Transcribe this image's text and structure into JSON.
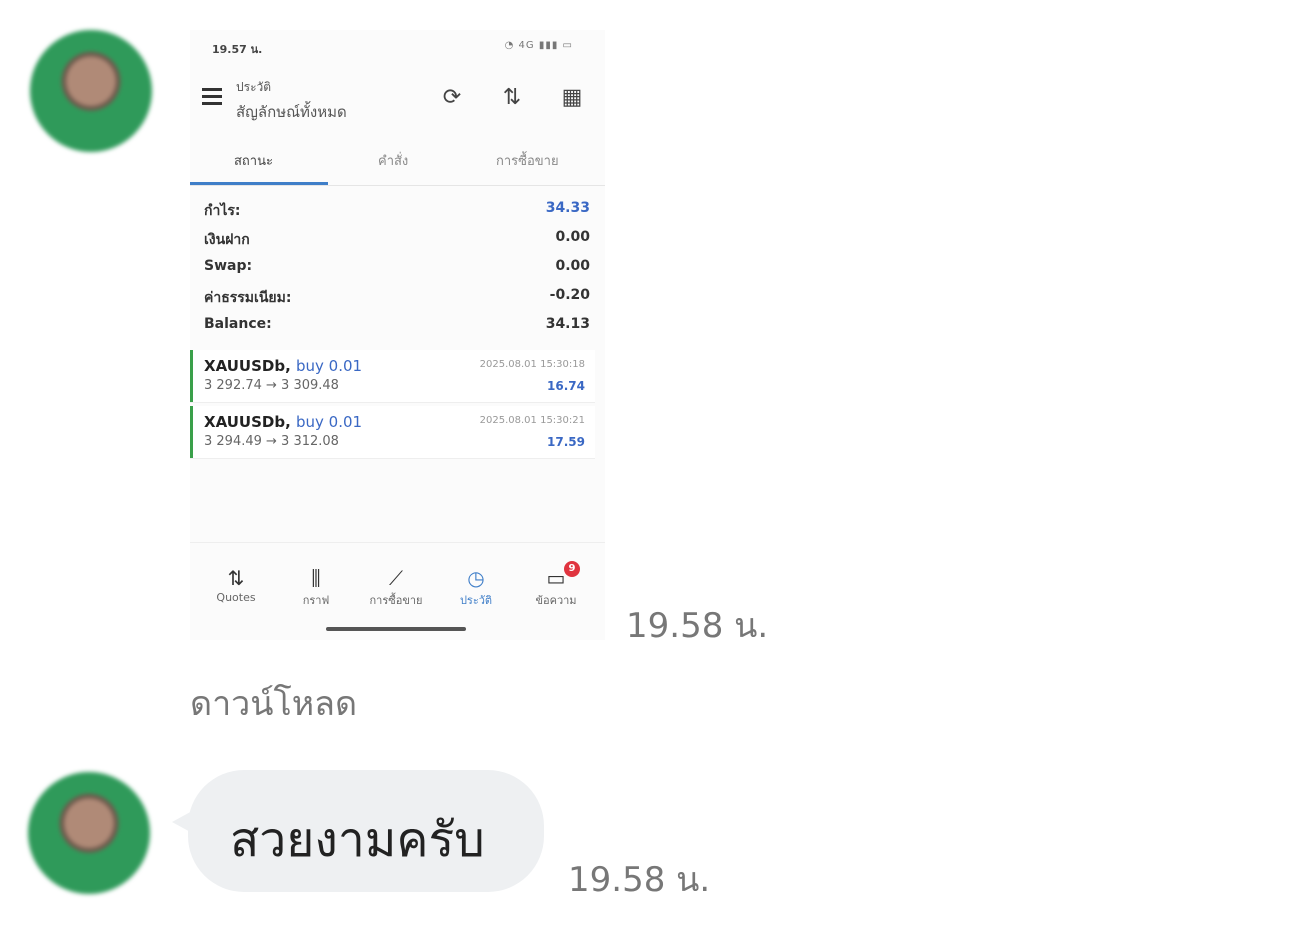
{
  "avatar_icon": "user-avatar",
  "screenshot": {
    "status_time": "19.57 น.",
    "status_icons": "WiFi 4G signal battery",
    "toolbar": {
      "title_small": "ประวัติ",
      "title_main": "สัญลักษณ์ทั้งหมด",
      "icons": [
        "sync-icon",
        "sort-icon",
        "calendar-icon"
      ]
    },
    "tabs": [
      "สถานะ",
      "คำสั่ง",
      "การซื้อขาย"
    ],
    "summary": [
      {
        "label": "กำไร:",
        "value": "34.33",
        "color": "#3a68c4"
      },
      {
        "label": "เงินฝาก",
        "value": "0.00"
      },
      {
        "label": "Swap:",
        "value": "0.00"
      },
      {
        "label": "ค่าธรรมเนียม:",
        "value": "-0.20"
      },
      {
        "label": "Balance:",
        "value": "34.13"
      }
    ],
    "trades": [
      {
        "symbol": "XAUUSDb,",
        "side": "buy 0.01",
        "prices": "3 292.74 → 3 309.48",
        "time": "2025.08.01 15:30:18",
        "profit": "16.74"
      },
      {
        "symbol": "XAUUSDb,",
        "side": "buy 0.01",
        "prices": "3 294.49 → 3 312.08",
        "time": "2025.08.01 15:30:21",
        "profit": "17.59"
      }
    ],
    "bottom_nav": [
      {
        "label": "Quotes",
        "icon": "quotes-icon"
      },
      {
        "label": "กราฟ",
        "icon": "chart-icon"
      },
      {
        "label": "การซื้อขาย",
        "icon": "trade-icon"
      },
      {
        "label": "ประวัติ",
        "icon": "history-icon"
      },
      {
        "label": "ข้อความ",
        "icon": "messages-icon",
        "badge": "9"
      }
    ]
  },
  "message1": {
    "timestamp": "19.58 น.",
    "download_label": "ดาวน์โหลด"
  },
  "message2": {
    "text": "สวยงามครับ",
    "timestamp": "19.58 น."
  }
}
